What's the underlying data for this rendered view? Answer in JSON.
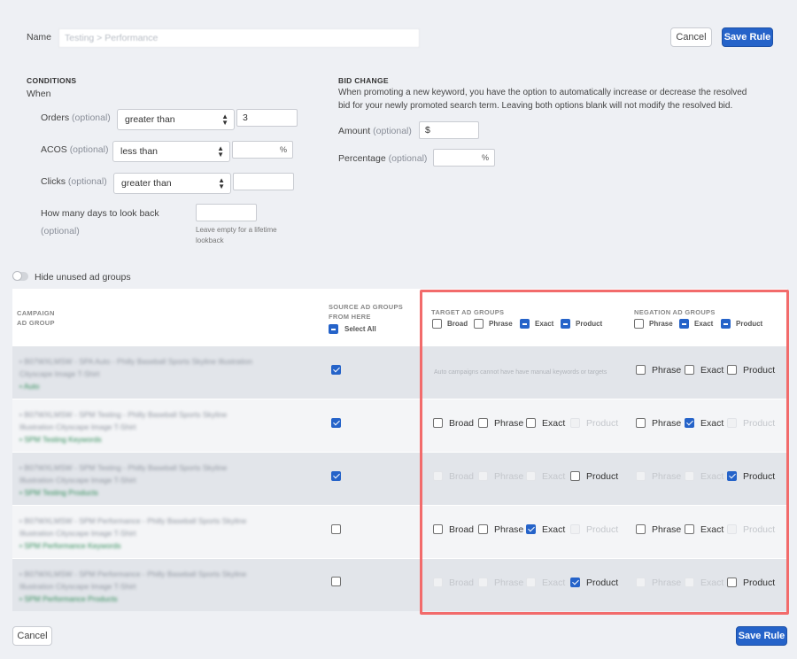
{
  "form": {
    "name_label": "Name",
    "name_value": "Testing > Performance",
    "cancel": "Cancel",
    "save": "Save Rule"
  },
  "conditions": {
    "title": "CONDITIONS",
    "when": "When",
    "orders_label": "Orders",
    "orders_opt": "(optional)",
    "orders_op": "greater than",
    "orders_value": "3",
    "acos_label": "ACOS",
    "acos_opt": "(optional)",
    "acos_op": "less than",
    "acos_unit": "%",
    "clicks_label": "Clicks",
    "clicks_opt": "(optional)",
    "clicks_op": "greater than",
    "lookback_label": "How many days to look back",
    "lookback_opt": "(optional)",
    "lookback_hint1": "Leave empty for a lifetime",
    "lookback_hint2": "lookback"
  },
  "bid": {
    "title": "BID CHANGE",
    "desc1": "When promoting a new keyword, you have the option to automatically increase or decrease the resolved",
    "desc2": "bid for your newly promoted search term. Leaving both options blank will not modify the resolved bid.",
    "amount_label": "Amount",
    "amount_opt": "(optional)",
    "amount_prefix": "$",
    "pct_label": "Percentage",
    "pct_opt": "(optional)",
    "pct_unit": "%"
  },
  "toggle": {
    "label": "Hide unused ad groups",
    "on": false
  },
  "table": {
    "col_campaign1": "CAMPAIGN",
    "col_campaign2": "AD GROUP",
    "col_source1": "SOURCE AD GROUPS",
    "col_source2": "FROM HERE",
    "select_all": "Select All",
    "col_target": "TARGET AD GROUPS",
    "col_negation": "NEGATION AD GROUPS",
    "broad": "Broad",
    "phrase": "Phrase",
    "exact": "Exact",
    "product": "Product",
    "auto_note": "Auto campaigns cannot have have manual keywords or targets",
    "rows": [
      {
        "l1": "• B07WXLMSW - SPA Auto - Philly Baseball Sports Skyline Illustration",
        "l2": "Cityscape Image T-Shirt",
        "l3": "• Auto"
      },
      {
        "l1": "• B07WXLMSW - SPM Testing - Philly Baseball Sports Skyline",
        "l2": "Illustration Cityscape Image T-Shirt",
        "l3": "• SPM Testing Keywords"
      },
      {
        "l1": "• B07WXLMSW - SPM Testing - Philly Baseball Sports Skyline",
        "l2": "Illustration Cityscape Image T-Shirt",
        "l3": "• SPM Testing Products"
      },
      {
        "l1": "• B07WXLMSW - SPM Performance - Philly Baseball Sports Skyline",
        "l2": "Illustration Cityscape Image T-Shirt",
        "l3": "• SPM Performance Keywords"
      },
      {
        "l1": "• B07WXLMSW - SPM Performance - Philly Baseball Sports Skyline",
        "l2": "Illustration Cityscape Image T-Shirt",
        "l3": "• SPM Performance Products"
      }
    ]
  },
  "colors": {
    "accent": "#2563c9",
    "highlight": "#f26b6b"
  }
}
